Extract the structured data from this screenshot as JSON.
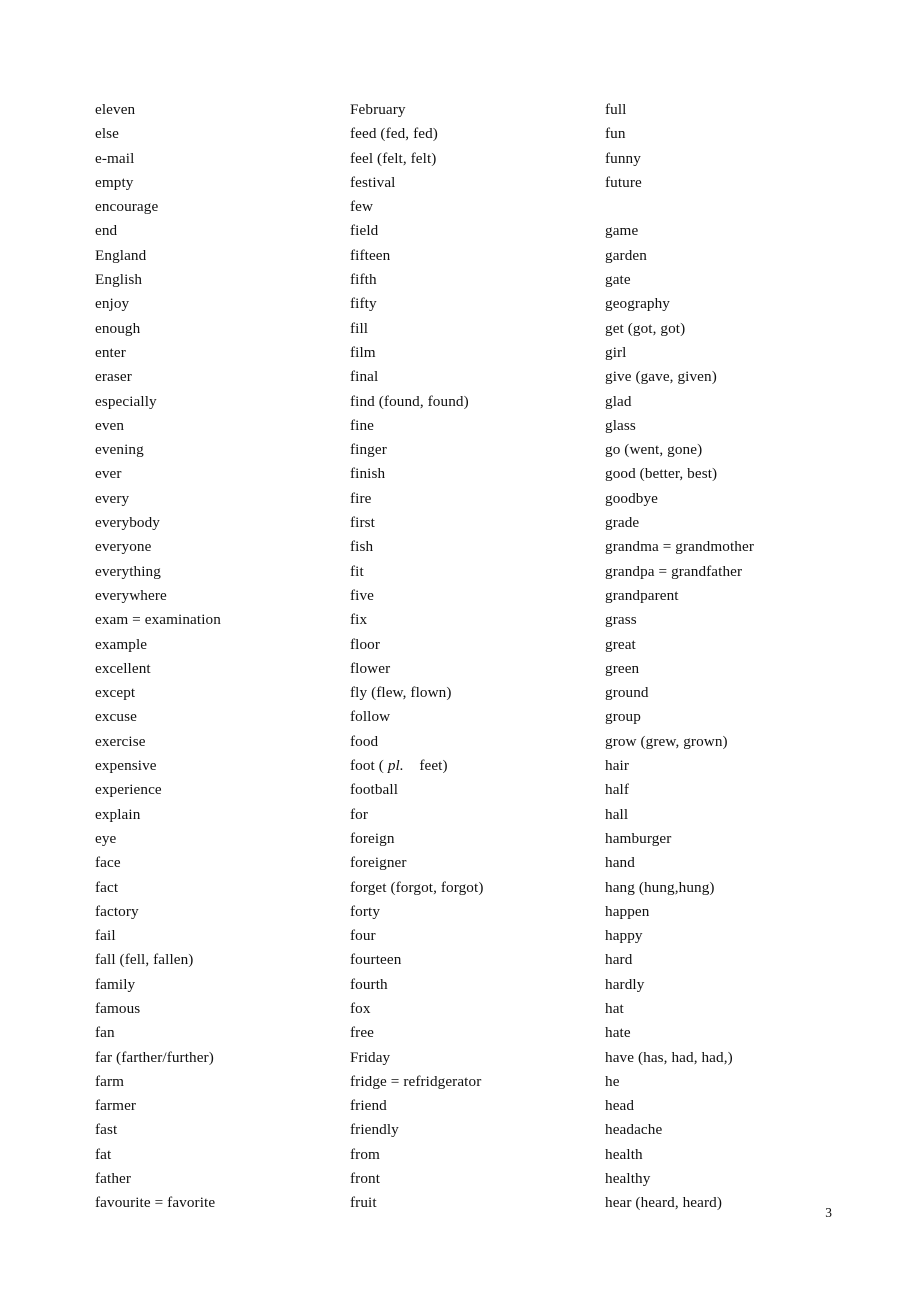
{
  "document": {
    "page_number": "3",
    "columns": [
      {
        "name": "column-1",
        "words": [
          "eleven",
          "else",
          "e-mail",
          "empty",
          "encourage",
          "end",
          "England",
          "English",
          "enjoy",
          "enough",
          "enter",
          "eraser",
          "especially",
          "even",
          "evening",
          "ever",
          "every",
          "everybody",
          "everyone",
          "everything",
          "everywhere",
          "exam = examination",
          "example",
          "excellent",
          "except",
          "excuse",
          "exercise",
          "expensive",
          "experience",
          "explain",
          "eye",
          "face",
          "fact",
          "factory",
          "fail",
          "fall (fell, fallen)",
          "family",
          "famous",
          "fan",
          "far (farther/further)",
          "farm",
          "farmer",
          "fast",
          "fat",
          "father",
          "favourite = favorite"
        ]
      },
      {
        "name": "column-2",
        "words": [
          "February",
          "feed (fed, fed)",
          "feel (felt, felt)",
          "festival",
          "few",
          "field",
          "fifteen",
          "fifth",
          "fifty",
          "fill",
          "film",
          "final",
          "find (found, found)",
          "fine",
          "finger",
          "finish",
          "fire",
          "first",
          "fish",
          "fit",
          "five",
          "fix",
          "floor",
          "flower",
          "fly (flew, flown)",
          "follow",
          "food",
          "foot ( pl.    feet)",
          "football",
          "for",
          "foreign",
          "foreigner",
          "forget (forgot, forgot)",
          "forty",
          "four",
          "fourteen",
          "fourth",
          "fox",
          "free",
          "Friday",
          "fridge = refridgerator",
          "friend",
          "friendly",
          "from",
          "front",
          "fruit"
        ]
      },
      {
        "name": "column-3",
        "words": [
          "full",
          "fun",
          "funny",
          "future",
          "",
          "game",
          "garden",
          "gate",
          "geography",
          "get (got, got)",
          "girl",
          "give (gave, given)",
          "glad",
          "glass",
          "go (went, gone)",
          "good (better, best)",
          "goodbye",
          "grade",
          "grandma = grandmother",
          "grandpa = grandfather",
          "grandparent",
          "grass",
          "great",
          "green",
          "ground",
          "group",
          "grow (grew, grown)",
          "hair",
          "half",
          "hall",
          "hamburger",
          "hand",
          "hang (hung,hung)",
          "happen",
          "happy",
          "hard",
          "hardly",
          "hat",
          "hate",
          "have (has, had, had,)",
          "he",
          "head",
          "headache",
          "health",
          "healthy",
          "hear (heard, heard)"
        ]
      }
    ]
  }
}
